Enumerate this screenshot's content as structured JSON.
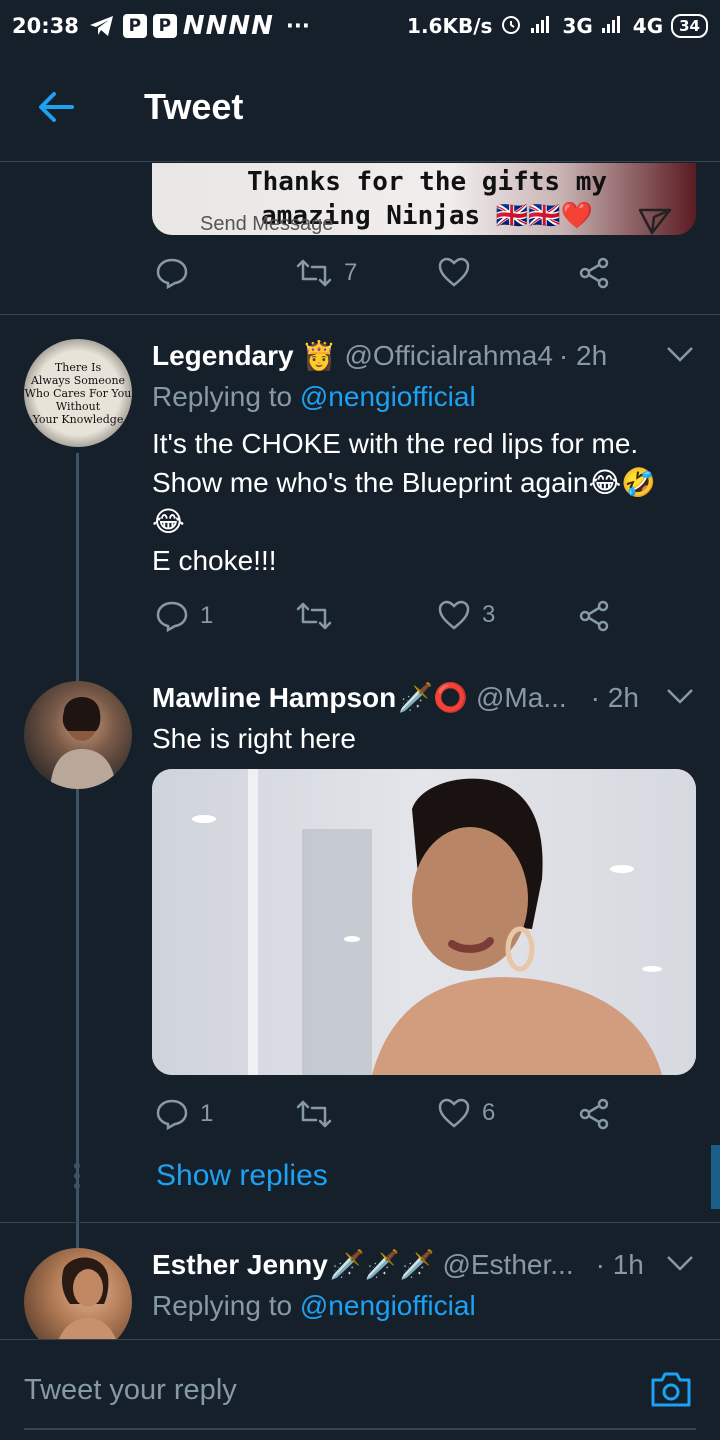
{
  "status_bar": {
    "time": "20:38",
    "app_letters": "NNNN",
    "dots": "···",
    "speed": "1.6KB/s",
    "network_1": "3G",
    "network_2": "4G",
    "battery": "34"
  },
  "header": {
    "title": "Tweet"
  },
  "top_tweet": {
    "media_caption_line1": "Thanks for the gifts my",
    "media_caption_line2": "amazing Ninjas 🇬🇧🇬🇧❤️",
    "media_send_label": "Send Message",
    "retweets": "7"
  },
  "tweets": [
    {
      "name": "Legendary",
      "name_emoji": "👸",
      "handle": "@Officialrahma4",
      "time": "· 2h",
      "avatar_text": [
        "There Is",
        "Always Someone",
        "Who Cares For You",
        "Without",
        "Your Knowledge"
      ],
      "replying_prefix": "Replying to",
      "replying_handle": "@nengiofficial",
      "text_lines": [
        "It's the CHOKE with the red lips for me.",
        "Show me who's the Blueprint again😂🤣",
        "😂",
        "E choke!!!"
      ],
      "replies": "1",
      "retweets": "",
      "likes": "3"
    },
    {
      "name": "Mawline Hampson",
      "name_emoji": "🗡️⭕",
      "handle": "@Ma...",
      "time": "· 2h",
      "text_lines": [
        "She is right here"
      ],
      "replies": "1",
      "retweets": "",
      "likes": "6",
      "show_replies": "Show replies"
    },
    {
      "name": "Esther Jenny",
      "name_emoji": "🗡️🗡️🗡️",
      "handle": "@Esther...",
      "time": "· 1h",
      "replying_prefix": "Replying to",
      "replying_handle": "@nengiofficial"
    }
  ],
  "reply_bar": {
    "placeholder": "Tweet your reply"
  },
  "colors": {
    "background": "#15202b",
    "accent": "#1da1f2",
    "secondary_text": "#8899a6",
    "divider": "#38444d"
  }
}
